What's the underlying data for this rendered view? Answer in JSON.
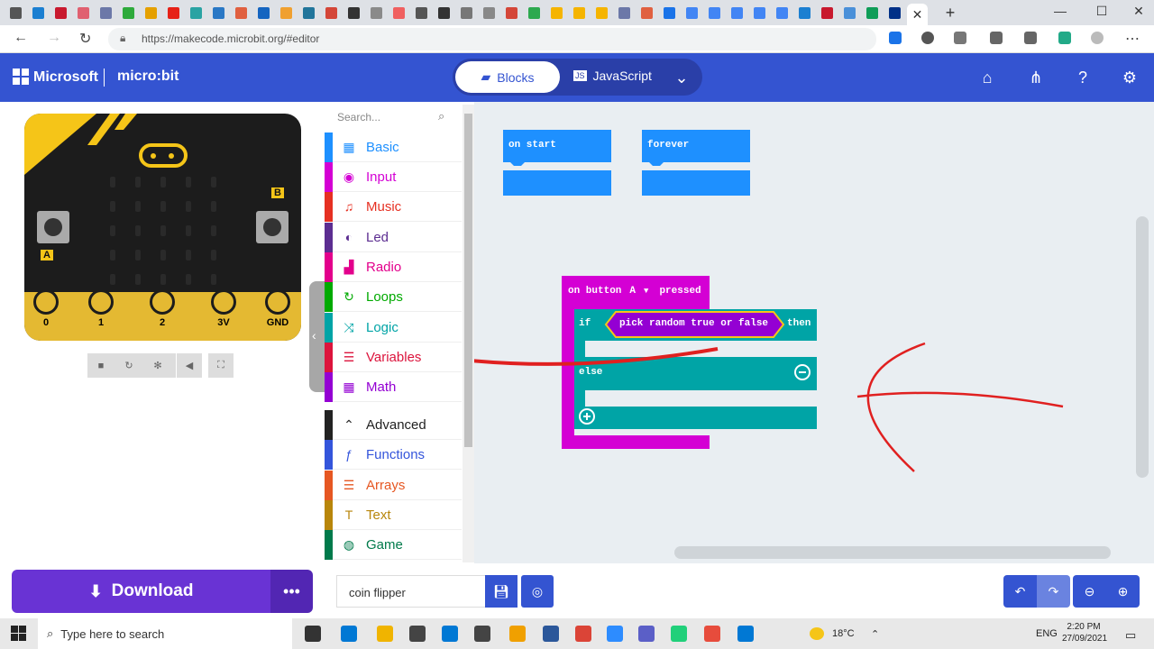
{
  "browser": {
    "tab_colors": [
      "#555",
      "#1b7fd1",
      "#c8192e",
      "#e06070",
      "#6c78a8",
      "#2eaa3c",
      "#e5a000",
      "#e62117",
      "#2aa3a3",
      "#2a78c5",
      "#e06040",
      "#1565c0",
      "#f0a030",
      "#21759b",
      "#d44638",
      "#333",
      "#8a8a8a",
      "#f06060",
      "#555",
      "#333",
      "#777",
      "#888",
      "#d44638",
      "#2da94f",
      "#f5b400",
      "#f5b400",
      "#f5b400",
      "#6c78a8",
      "#e06040",
      "#1a73e8",
      "#4285f4",
      "#4285f4",
      "#4285f4",
      "#4285f4",
      "#4285f4",
      "#1b7fd1",
      "#c8192e",
      "#4a90d9",
      "#0f9d58",
      "#003087"
    ],
    "close_glyph": "✕",
    "new_tab_glyph": "+",
    "url": "https://makecode.microbit.org/#editor"
  },
  "header": {
    "brand": "Microsoft",
    "product": "micro:bit",
    "blocks_label": "Blocks",
    "js_label": "JavaScript",
    "accent": "#3454d1"
  },
  "simulator": {
    "pins": [
      "0",
      "1",
      "2",
      "3V",
      "GND"
    ],
    "button_a": "A",
    "button_b": "B"
  },
  "toolbox": {
    "search_placeholder": "Search...",
    "categories": [
      {
        "label": "Basic",
        "color": "#1e90ff",
        "icon": "grid-icon",
        "glyph": "▦"
      },
      {
        "label": "Input",
        "color": "#d400d4",
        "icon": "target-icon",
        "glyph": "◉"
      },
      {
        "label": "Music",
        "color": "#e63022",
        "icon": "headphones-icon",
        "glyph": "♫"
      },
      {
        "label": "Led",
        "color": "#5c2d91",
        "icon": "toggle-icon",
        "glyph": "◐"
      },
      {
        "label": "Radio",
        "color": "#e3008c",
        "icon": "signal-icon",
        "glyph": "▟"
      },
      {
        "label": "Loops",
        "color": "#00aa00",
        "icon": "refresh-icon",
        "glyph": "↻"
      },
      {
        "label": "Logic",
        "color": "#00a4a6",
        "icon": "shuffle-icon",
        "glyph": "⤨"
      },
      {
        "label": "Variables",
        "color": "#dc143c",
        "icon": "list-icon",
        "glyph": "☰"
      },
      {
        "label": "Math",
        "color": "#9400d3",
        "icon": "calculator-icon",
        "glyph": "▦"
      },
      {
        "label": "Advanced",
        "color": "#222222",
        "icon": "chevron-up-icon",
        "glyph": "⌃"
      },
      {
        "label": "Functions",
        "color": "#3455db",
        "icon": "function-icon",
        "glyph": "ƒ"
      },
      {
        "label": "Arrays",
        "color": "#e65722",
        "icon": "list-icon",
        "glyph": "☰"
      },
      {
        "label": "Text",
        "color": "#b8860b",
        "icon": "text-icon",
        "glyph": "T"
      },
      {
        "label": "Game",
        "color": "#007a4b",
        "icon": "gamepad-icon",
        "glyph": "◍"
      }
    ]
  },
  "workspace": {
    "on_start": "on start",
    "forever": "forever",
    "event_prefix": "on button",
    "event_button": "A",
    "event_suffix": "pressed",
    "if_label": "if",
    "condition": "pick random true or false",
    "then_label": "then",
    "else_label": "else"
  },
  "footer": {
    "download": "Download",
    "more": "•••",
    "project_name": "coin flipper"
  },
  "taskbar": {
    "search_placeholder": "Type here to search",
    "app_colors": [
      "#333",
      "#0078d4",
      "#f0b400",
      "#444",
      "#0078d4",
      "#444",
      "#f0a000",
      "#2b579a",
      "#db4437",
      "#2d8cff",
      "#5b5fc7",
      "#21d07a",
      "#e74c3c",
      "#0078d4"
    ],
    "temperature": "18°C",
    "language": "ENG",
    "time": "2:20 PM",
    "date": "27/09/2021"
  }
}
